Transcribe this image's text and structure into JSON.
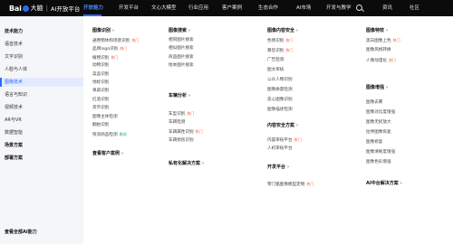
{
  "brand": {
    "bai": "Bai",
    "du": "大脑",
    "separator": "|",
    "product": "AI开放平台"
  },
  "nav": {
    "items": [
      {
        "label": "开放能力",
        "active": true
      },
      {
        "label": "开发平台"
      },
      {
        "label": "文心大模型"
      },
      {
        "label": "行业应用"
      },
      {
        "label": "客户案例"
      },
      {
        "label": "生态合作"
      },
      {
        "label": "AI市场"
      },
      {
        "label": "开发与教学"
      },
      {
        "label": "资讯"
      },
      {
        "label": "社区"
      }
    ]
  },
  "sidebar": {
    "items": [
      {
        "label": "技术能力",
        "kind": "head"
      },
      {
        "label": "语音技术"
      },
      {
        "label": "文字识别"
      },
      {
        "label": "人脸与人体"
      },
      {
        "label": "图像技术",
        "active": true
      },
      {
        "label": "语言与知识"
      },
      {
        "label": "视频技术"
      },
      {
        "label": "AR与VR"
      },
      {
        "label": "数据智能"
      },
      {
        "label": "场景方案",
        "kind": "head"
      },
      {
        "label": "部署方案",
        "kind": "head"
      }
    ],
    "footer": "查看全部AI能力"
  },
  "columns": [
    {
      "sections": [
        {
          "title": "图像识别",
          "links": [
            {
              "label": "通用物体和场景识别",
              "badge": "热门",
              "badge_type": "hot"
            },
            {
              "label": "品牌logo识别",
              "badge": "热门",
              "badge_type": "hot"
            },
            {
              "label": "植物识别",
              "badge": "热门",
              "badge_type": "hot"
            },
            {
              "label": "动物识别"
            },
            {
              "label": "菜品识别"
            },
            {
              "label": "地标识别"
            },
            {
              "label": "果蔬识别"
            },
            {
              "label": "红酒识别"
            },
            {
              "label": "货币识别"
            },
            {
              "label": "图像主体检测"
            },
            {
              "label": "翻拍识别"
            },
            {
              "label": "快消商品检测",
              "badge": "邀测",
              "badge_type": "new"
            }
          ]
        },
        {
          "title": "查看客户案例",
          "links": []
        }
      ]
    },
    {
      "sections": [
        {
          "title": "图像搜索",
          "links": [
            {
              "label": "相同图片搜索"
            },
            {
              "label": "相似图片搜索"
            },
            {
              "label": "商品图片搜索"
            },
            {
              "label": "绘本图片搜索"
            }
          ]
        },
        {
          "title": "车辆分析",
          "links": [
            {
              "label": "车型识别",
              "badge": "热门",
              "badge_type": "hot"
            },
            {
              "label": "车辆检测"
            },
            {
              "label": "车辆属性识别",
              "badge": "热门",
              "badge_type": "hot"
            },
            {
              "label": "车辆损伤识别"
            }
          ]
        },
        {
          "title": "私有化解决方案",
          "links": []
        }
      ]
    },
    {
      "sections": [
        {
          "title": "图像内容安全",
          "links": [
            {
              "label": "色情识别",
              "badge": "热门",
              "badge_type": "hot"
            },
            {
              "label": "暴恐识别",
              "badge": "热门",
              "badge_type": "hot"
            },
            {
              "label": "广告检测"
            },
            {
              "label": "图文审核"
            },
            {
              "label": "公众人物识别"
            },
            {
              "label": "图像质量检测"
            },
            {
              "label": "恶心图像识别"
            },
            {
              "label": "图像描述检测"
            }
          ]
        },
        {
          "title": "内容安全方案",
          "links": [
            {
              "label": "内容审核平台",
              "badge": "热门",
              "badge_type": "hot"
            },
            {
              "label": "人机审核平台"
            }
          ]
        },
        {
          "title": "开发平台",
          "links": [
            {
              "label": "零门槛图像模型定制",
              "badge": "热门",
              "badge_type": "hot"
            }
          ]
        }
      ]
    },
    {
      "sections": [
        {
          "title": "图像特效",
          "links": [
            {
              "label": "黑白图像上色",
              "badge": "热门",
              "badge_type": "hot"
            },
            {
              "label": "图像风格转换"
            },
            {
              "label": "人像动漫化",
              "badge": "热门",
              "badge_type": "hot"
            }
          ]
        },
        {
          "title": "图像增强",
          "links": [
            {
              "label": "图像去雾"
            },
            {
              "label": "图像对比度增强"
            },
            {
              "label": "图像无损放大"
            },
            {
              "label": "拉伸图像恢复"
            },
            {
              "label": "图像修复"
            },
            {
              "label": "图像清晰度增强"
            },
            {
              "label": "图像色彩增强"
            }
          ]
        },
        {
          "title": "AI中台解决方案",
          "links": []
        }
      ]
    }
  ]
}
